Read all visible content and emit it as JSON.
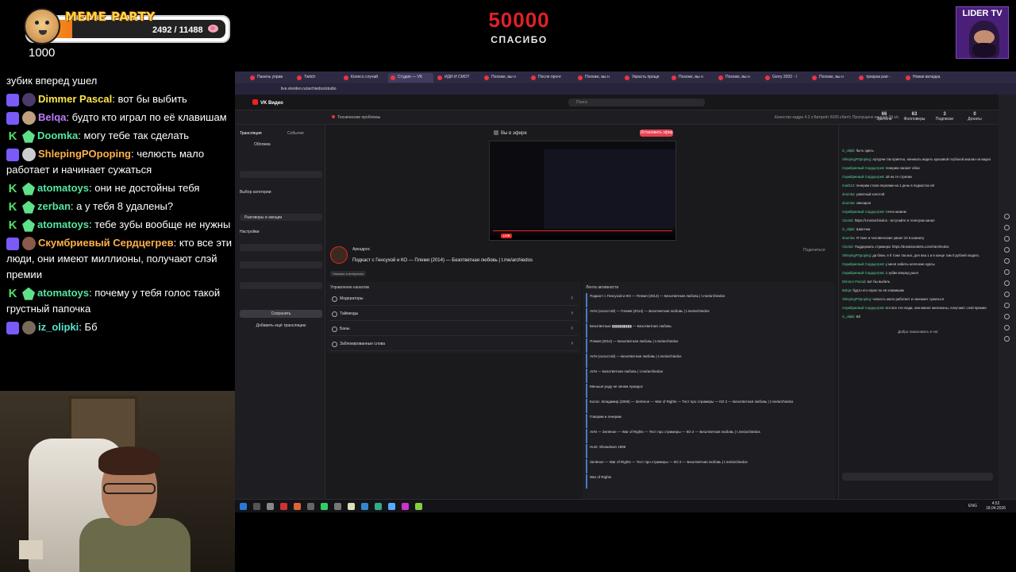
{
  "widget": {
    "title": "MEME PARTY",
    "progress_text": "2492 / 11488",
    "progress_fraction": 0.217,
    "count": "1000"
  },
  "goal": {
    "amount": "50000",
    "label": "СПАСИБО"
  },
  "channel_logo": {
    "text": "LIDER TV"
  },
  "chat": {
    "messages": [
      {
        "badges": [],
        "user": "",
        "text": "зубик вперед ушел"
      },
      {
        "badges": [
          "live",
          "avatar"
        ],
        "user": "Dimmer Pascal",
        "user_color": "#ffe54a",
        "text": "вот бы выбить"
      },
      {
        "badges": [
          "live",
          "avatar"
        ],
        "user": "Belqa",
        "user_color": "#c27bff",
        "text": "будто кто играл по её клавишам"
      },
      {
        "badges": [
          "kick",
          "gem"
        ],
        "user": "Doomka",
        "user_color": "#54e6a0",
        "text": "могу тебе так сделать"
      },
      {
        "badges": [
          "live",
          "avatar"
        ],
        "user": "ShlepingPOpoping",
        "user_color": "#ffb04a",
        "text": "челюсть мало работает и начинает сужаться"
      },
      {
        "badges": [
          "kick",
          "gem"
        ],
        "user": "atomatoys",
        "user_color": "#54e6a0",
        "text": "они не достойны тебя"
      },
      {
        "badges": [
          "kick",
          "gem"
        ],
        "user": "zerban",
        "user_color": "#54e6a0",
        "text": "а у тебя 8 удалены?"
      },
      {
        "badges": [
          "kick",
          "gem"
        ],
        "user": "atomatoys",
        "user_color": "#54e6a0",
        "text": "тебе зубы вообще не нужны"
      },
      {
        "badges": [
          "live",
          "avatar"
        ],
        "user": "Скумбриевый Сердцегрев",
        "user_color": "#ffb04a",
        "text": "кто все эти люди, они имеют миллионы, получают слэй премии"
      },
      {
        "badges": [
          "kick",
          "gem"
        ],
        "user": "atomatoys",
        "user_color": "#54e6a0",
        "text": "почему у тебя голос такой грустный папочка"
      },
      {
        "badges": [
          "live",
          "avatar"
        ],
        "user": "iz_olipki",
        "user_color": "#59e3cc",
        "text": "Бб"
      }
    ]
  },
  "screen": {
    "tabs": [
      {
        "label": "Панель управ"
      },
      {
        "label": "Twitch"
      },
      {
        "label": "Колесо случай"
      },
      {
        "label": "Студия — VK",
        "active": true
      },
      {
        "label": "ИДИ И СМОТ"
      },
      {
        "label": "Похоже, вы н"
      },
      {
        "label": "После прочт"
      },
      {
        "label": "Похоже, вы н"
      },
      {
        "label": "Украсть проще"
      },
      {
        "label": "Похоже, вы н"
      },
      {
        "label": "Похоже, вы н"
      },
      {
        "label": "Gerry 2002 - I"
      },
      {
        "label": "Похоже, вы н"
      },
      {
        "label": "тризрак рая -"
      },
      {
        "label": "Новая вкладка"
      }
    ],
    "url": "live.vkvideo.ru/archiedos/studio",
    "app_name": "VK Видео",
    "search_placeholder": "Поиск",
    "issue_label": "Технические проблемы",
    "stats_text": "Качество кадра 4.2 к Битрейт 6025 кбит/с Пропущено кадров 39 к/с",
    "stat_boxes": [
      {
        "value": "66",
        "label": "Зрители"
      },
      {
        "value": "63",
        "label": "Фолловеры"
      },
      {
        "value": "3",
        "label": "Подписки"
      },
      {
        "value": "0",
        "label": "Донаты"
      }
    ],
    "left_panel": {
      "tab_broadcast": "Трансляция",
      "tab_events": "События",
      "account": "Аркадрос",
      "promo_label": "Обложка",
      "category_heading": "Выбор категории",
      "category_value": "Разговоры и эмоции",
      "settings_heading": "Настройки",
      "save_button": "Сохранить",
      "add_button": "Добавить ещё трансляцию"
    },
    "center": {
      "status": "Вы в эфире",
      "stop_button": "Остановить эфир",
      "live_tag": "LIVE",
      "streamer": "Аркадрос",
      "title": "Подкаст с Генсухой и КО — Племя (2014) — Безответная любовь | t.me/archiedos",
      "share": "Поделиться",
      "tag": "Смешно и интересно",
      "management_heading": "Управление каналом",
      "management_items": [
        "Модераторы",
        "Таймкоды",
        "Баны",
        "Заблокированные слова"
      ],
      "feed_heading": "Лента активности",
      "feed_items": [
        "Подкаст с Генсухой и КО — Племя (2014) — Безответная любовь | t.me/archiedos",
        "AVN (холостой) — Племя (2014) — Безответная любовь | t.me/archiedos",
        "Безответные ▮▮▮▮▮▮▮▮▮▮ — Безответная любовь",
        "Племя (2014) — Безответная любовь | t.me/archiedos",
        "AVN (холостой) — Безответная любовь | t.me/archiedos",
        "AVN — Безответная любовь | t.me/archiedos",
        "Меньше роду не зачем Архидос",
        "Колос. Владимир (2006) — Зелёное — War of Rights — Тест про стримеры — КО 2 — Безответная любовь | t.me/archiedos",
        "Говорим и генерим",
        "AVN — Зелёное — War of Rights — Тест про стримеры — КО 2 — Безответная любовь | t.me/archiedos",
        "Hunt: Showdown 1896",
        "Зелёное — War of Rights — Тест про стримеры — КО 2 — Безответная любовь | t.me/archiedos",
        "War of Rights"
      ]
    },
    "right_chat": {
      "lines": [
        {
          "user": "iz_olipki",
          "text": "быть здесь"
        },
        {
          "user": "ShlepingPOpoping",
          "text": "Артурчи так приятно, начинать видеть красивой глубокой анализ на видео"
        },
        {
          "user": "Скумбриевый Сердцегрев",
          "text": "генерим сможет обои"
        },
        {
          "user": "Скумбриевый Сердцегрев",
          "text": "ой на те стрелки"
        },
        {
          "user": "mad112",
          "text": "генерим стали перлами на 1 день в подкастах ей"
        },
        {
          "user": "doomka",
          "text": "ухватный золотой"
        },
        {
          "user": "doomka",
          "text": "свисарон"
        },
        {
          "user": "Скумбриевый Сердцегрев",
          "text": "точно можем"
        },
        {
          "user": "Cloritol",
          "text": "https://t.me/archiedos - вступайте в телеграм канал"
        },
        {
          "user": "iz_olipki",
          "text": "Шапочки"
        },
        {
          "user": "doomka",
          "text": "Я тоже и человеческие увеил 10 в комнату"
        },
        {
          "user": "Cloritol",
          "text": "Поддержать стримера: https://donationalerts.com/r/archiedos"
        },
        {
          "user": "ShlepingPOpoping",
          "text": "да блин, я б тоже так мог, для пиа 1 и в конце там 0 рублей людить"
        },
        {
          "user": "Скумбриевый Сердцегрев",
          "text": "у меня забиты неплохие курсы"
        },
        {
          "user": "Скумбриевый Сердцегрев",
          "text": "1 зубик вперед ушел"
        },
        {
          "user": "Dimmer Pascal",
          "text": "вот бы выбить"
        },
        {
          "user": "Belqa",
          "text": "будто кто играл по её клавишам"
        },
        {
          "user": "ShlepingPOpoping",
          "text": "челюсть мало работает и начинает сужаться"
        },
        {
          "user": "Скумбриевый Сердцегрев",
          "text": "кто все эти люди, они имеют миллионы, получают слэй премии"
        },
        {
          "user": "iz_olipki",
          "text": "Бб"
        }
      ],
      "welcome": "Добро пожаловать в чат"
    },
    "taskbar": {
      "lang": "ENG",
      "time": "4:52",
      "date": "18.04.2026"
    }
  }
}
